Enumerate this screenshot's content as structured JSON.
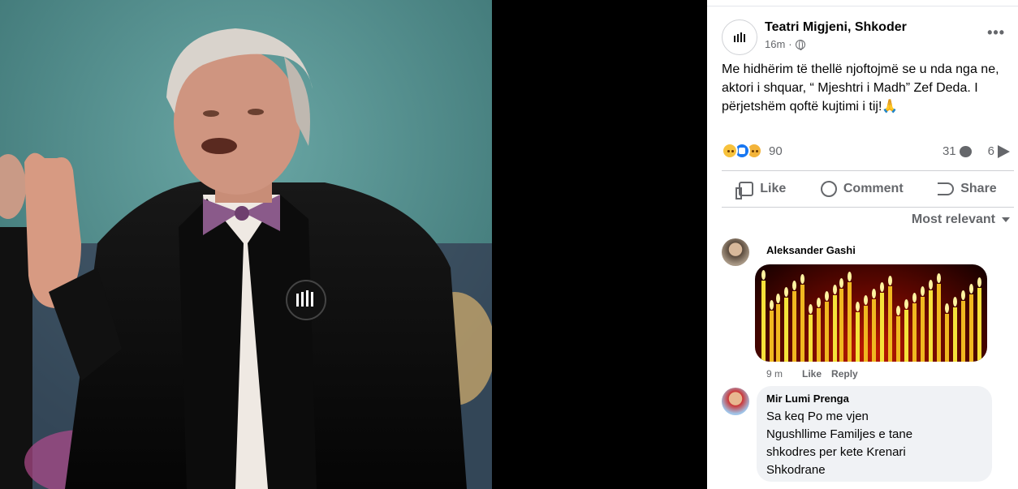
{
  "post": {
    "page_name": "Teatri Migjeni, Shkoder",
    "time": "16m",
    "more": "•••",
    "text": "Me hidhërim të thellë njoftojmë se u nda nga ne, aktori i shquar, “ Mjeshtri i Madh” Zef Deda. I përjetshëm qoftë kujtimi i tij!🙏",
    "reaction_count": "90",
    "comment_count": "31",
    "share_count": "6"
  },
  "actions": {
    "like": "Like",
    "comment": "Comment",
    "share": "Share"
  },
  "sort_label": "Most relevant",
  "comments": [
    {
      "author": "Aleksander Gashi",
      "time": "9 m",
      "like": "Like",
      "reply": "Reply"
    },
    {
      "author": "Mir Lumi Prenga",
      "text": "Sa keq Po me vjen\nNgushllime Familjes e tane\nshkodres per kete Krenari\nShkodrane"
    }
  ],
  "icons": {
    "avatar": "teatri-logo-icon",
    "privacy": "globe-icon",
    "like": "thumbs-up-icon",
    "comment": "speech-bubble-icon",
    "share": "share-arrow-icon"
  },
  "colors": {
    "panel_bg": "#ffffff",
    "secondary_text": "#65676b",
    "like_blue": "#1877f2",
    "comment_bubble": "#f0f2f5"
  }
}
